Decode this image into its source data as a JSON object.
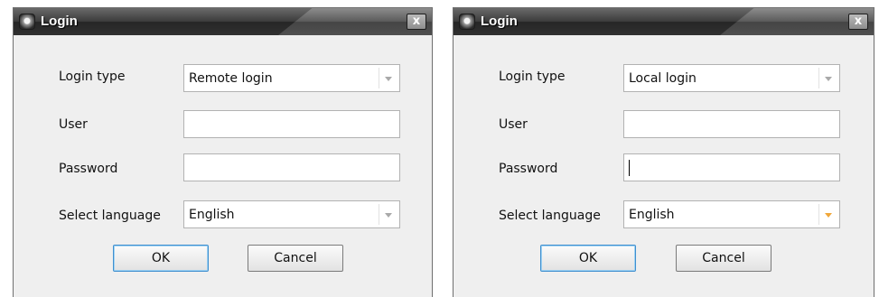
{
  "dialogs": [
    {
      "title": "Login",
      "close_glyph": "x",
      "login_type_label": "Login type",
      "login_type_value": "Remote login",
      "user_label": "User",
      "user_value": "",
      "password_label": "Password",
      "password_value": "",
      "language_label": "Select language",
      "language_value": "English",
      "ok_label": "OK",
      "cancel_label": "Cancel"
    },
    {
      "title": "Login",
      "close_glyph": "x",
      "login_type_label": "Login type",
      "login_type_value": "Local login",
      "user_label": "User",
      "user_value": "",
      "password_label": "Password",
      "password_value": "",
      "language_label": "Select language",
      "language_value": "English",
      "ok_label": "OK",
      "cancel_label": "Cancel"
    }
  ],
  "colors": {
    "title_bar": "#303030",
    "dialog_bg": "#efefef",
    "default_button_border": "#3f8fcf",
    "active_arrow": "#f0a73a"
  },
  "icons": {
    "app": "camera-icon",
    "close": "close-icon",
    "dropdown": "chevron-down-icon"
  }
}
